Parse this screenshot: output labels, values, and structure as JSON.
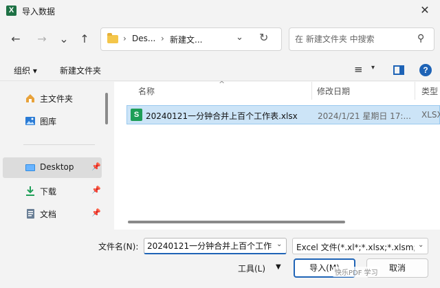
{
  "window": {
    "title": "导入数据",
    "app_icon": "X",
    "close": "✕"
  },
  "nav": {
    "back": "←",
    "forward": "→",
    "history": "⌄",
    "up": "↑",
    "breadcrumb": [
      "Des...",
      "新建文..."
    ],
    "crumb_sep": "›",
    "dropdown": "⌄",
    "refresh": "↻",
    "search_placeholder": "在 新建文件夹 中搜索",
    "search_icon": "⚲"
  },
  "toolbar": {
    "organize": "组织 ▾",
    "new_folder": "新建文件夹",
    "view_icon": "≡",
    "view_caret": "▾",
    "help": "?"
  },
  "sidebar": {
    "items": [
      {
        "label": "主文件夹",
        "icon": "home-icon"
      },
      {
        "label": "图库",
        "icon": "gallery-icon"
      },
      {
        "label": "Desktop",
        "icon": "desktop-icon",
        "pinned": true
      },
      {
        "label": "下载",
        "icon": "download-icon",
        "pinned": true
      },
      {
        "label": "文档",
        "icon": "document-icon",
        "pinned": true
      }
    ],
    "pin": "📌"
  },
  "file_list": {
    "columns": [
      "名称",
      "修改日期",
      "类型"
    ],
    "sort_caret": "^",
    "rows": [
      {
        "name": "20240121一分钟合并上百个工作表.xlsx",
        "date": "2024/1/21 星期日 17:...",
        "type": "XLSX",
        "icon": "S"
      }
    ]
  },
  "bottom": {
    "filename_label": "文件名(N):",
    "filename_value": "20240121一分钟合并上百个工作",
    "filetype": "Excel 文件(*.xl*;*.xlsx;*.xlsm;*",
    "tools": "工具(L)",
    "tools_caret": "▼",
    "import": "导入(M)",
    "cancel": "取消",
    "drop": "⌄",
    "watermark": "快乐PDF 学习"
  }
}
